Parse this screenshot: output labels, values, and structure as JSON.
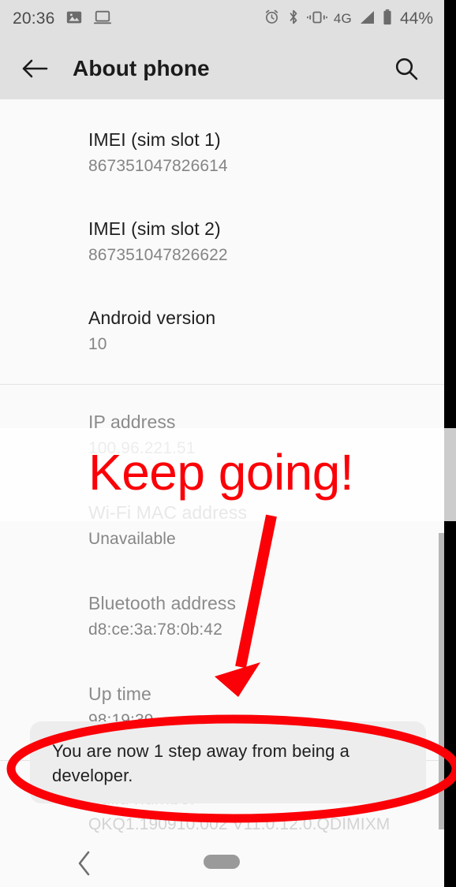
{
  "status_bar": {
    "time": "20:36",
    "left_icons": [
      "screenshot-icon",
      "cast-laptop-icon"
    ],
    "right_icons": [
      "alarm-icon",
      "bluetooth-icon",
      "vibrate-icon",
      "signal-icon",
      "battery-icon"
    ],
    "network_label": "4G",
    "battery_percent": "44%"
  },
  "appbar": {
    "back_label": "back-arrow",
    "title": "About phone",
    "search_label": "search"
  },
  "list": [
    {
      "title": "IMEI (sim slot 1)",
      "value": "867351047826614",
      "dim": false
    },
    {
      "title": "IMEI (sim slot 2)",
      "value": "867351047826622",
      "dim": false
    },
    {
      "title": "Android version",
      "value": "10",
      "dim": false
    },
    {
      "title": "IP address",
      "value": "100.96.221.51",
      "dim": true
    },
    {
      "title": "Wi-Fi MAC address",
      "value": "Unavailable",
      "dim": true
    },
    {
      "title": "Bluetooth address",
      "value": "d8:ce:3a:78:0b:42",
      "dim": true
    },
    {
      "title": "Up time",
      "value": "98:19:39",
      "dim": true
    },
    {
      "title": "Build number",
      "value": "QKQ1.190910.002 V11.0.12.0.QDIMIXM",
      "dim": true
    }
  ],
  "toast": {
    "message": "You are now 1 step away from being a developer."
  },
  "navbar": {
    "back_label": "back-chevron",
    "home_label": "home-pill"
  },
  "annotation": {
    "headline": "Keep going!",
    "color": "#fb0007",
    "arrow_name": "red-arrow-annotation",
    "ellipse_name": "red-ellipse-annotation"
  },
  "colors": {
    "appbar_bg": "#e0e0e0",
    "page_bg": "#fafafa",
    "toast_bg": "#ededed",
    "annotation_red": "#fb0007"
  }
}
